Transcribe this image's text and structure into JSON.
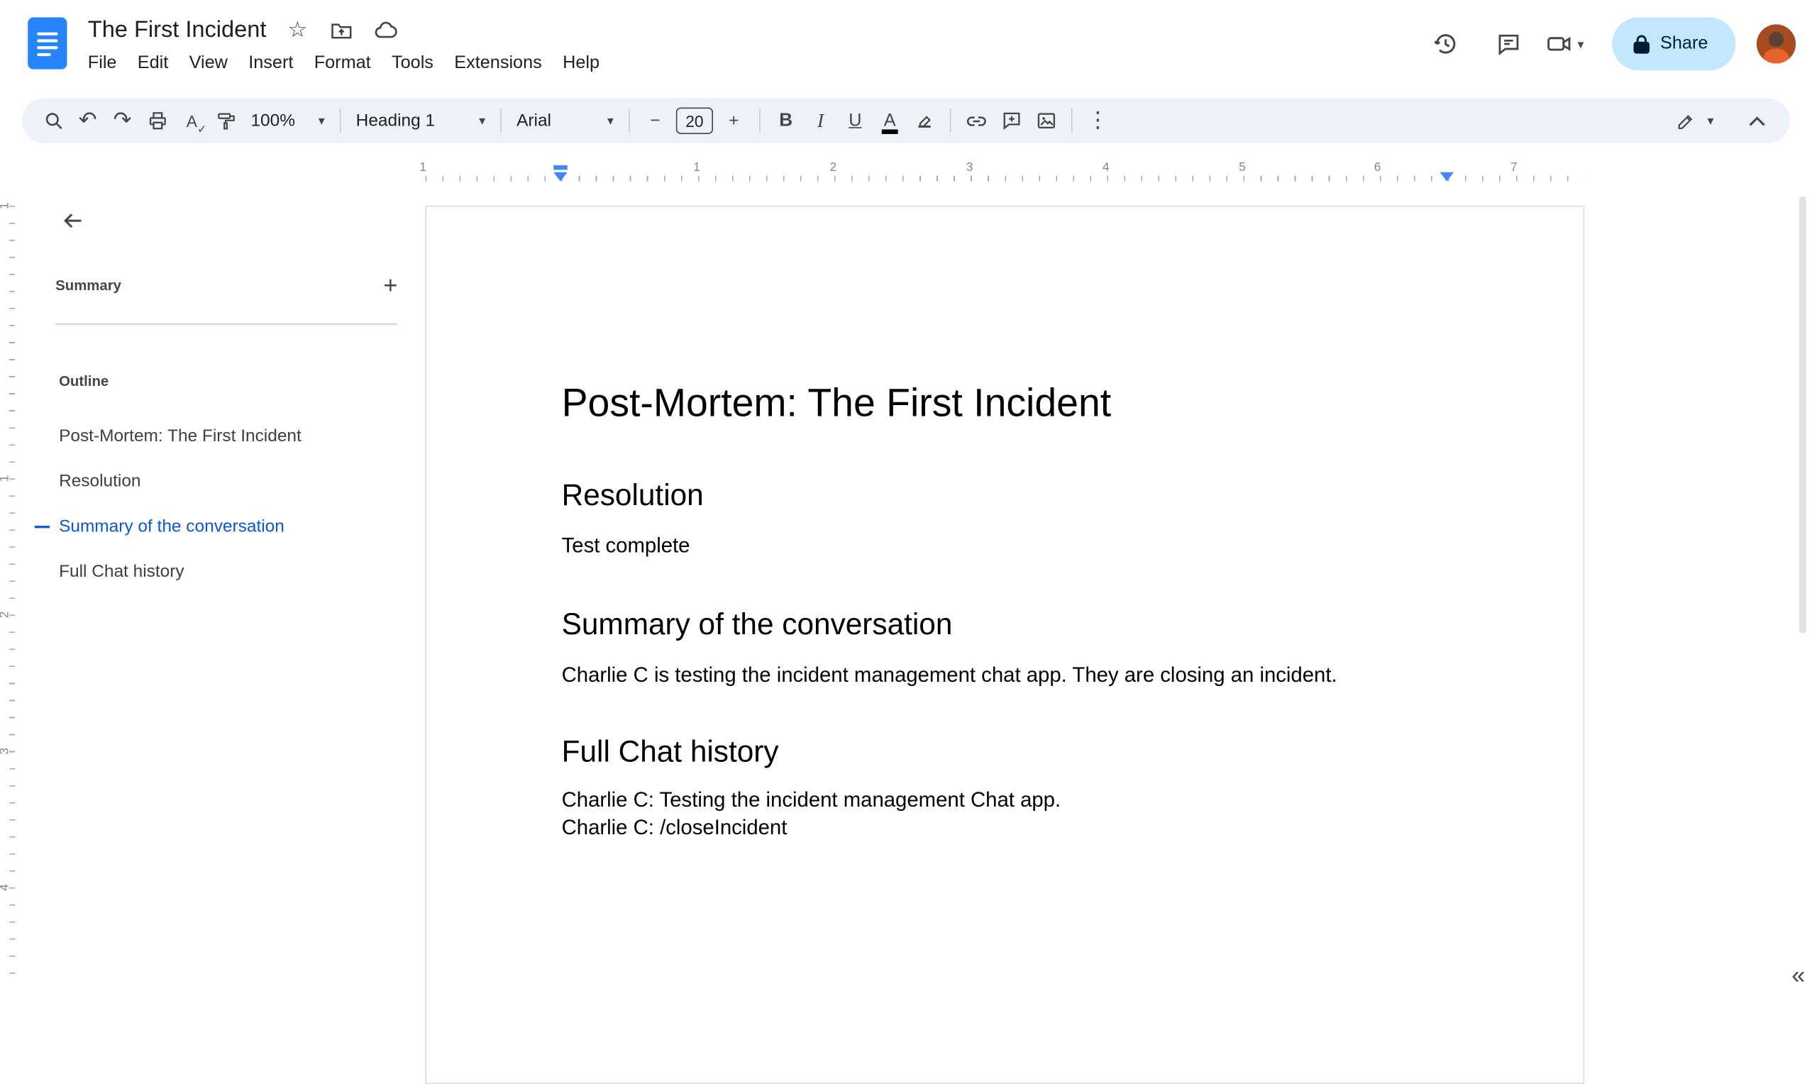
{
  "header": {
    "doc_title": "The First Incident",
    "menus": [
      "File",
      "Edit",
      "View",
      "Insert",
      "Format",
      "Tools",
      "Extensions",
      "Help"
    ],
    "share_label": "Share"
  },
  "toolbar": {
    "zoom_value": "100%",
    "style_value": "Heading 1",
    "font_value": "Arial",
    "font_size_value": "20",
    "bold_label": "B",
    "italic_label": "I",
    "underline_label": "U",
    "text_color_label": "A",
    "spellcheck_label": "A"
  },
  "icons": {
    "star": "☆",
    "undo": "↶",
    "redo": "↷",
    "minus": "−",
    "plus": "+",
    "add": "+",
    "caret": "▾",
    "more_vert": "⋮",
    "spell_check_mark": "✓",
    "collapse_panel": "«"
  },
  "ruler": {
    "h_numbers": [
      "1",
      "1",
      "2",
      "3",
      "4",
      "5",
      "6",
      "7"
    ],
    "v_numbers": [
      "1",
      "1",
      "2",
      "3",
      "4"
    ]
  },
  "sidebar": {
    "summary_label": "Summary",
    "outline_label": "Outline",
    "items": [
      {
        "label": "Post-Mortem: The First Incident",
        "active": false
      },
      {
        "label": "Resolution",
        "active": false
      },
      {
        "label": "Summary of the conversation",
        "active": true
      },
      {
        "label": "Full Chat history",
        "active": false
      }
    ]
  },
  "document": {
    "title": "Post-Mortem: The First Incident",
    "sections": [
      {
        "heading": "Resolution",
        "paragraphs": [
          "Test complete"
        ]
      },
      {
        "heading": "Summary of the conversation",
        "paragraphs": [
          "Charlie C is testing the incident management chat app. They are closing an incident."
        ]
      },
      {
        "heading": "Full Chat history",
        "paragraphs": [
          "Charlie C: Testing the incident management Chat app.",
          "Charlie C: /closeIncident"
        ]
      }
    ]
  },
  "colors": {
    "accent_blue": "#0b57d0",
    "share_bg": "#c2e7ff",
    "toolbar_bg": "#edf2fa",
    "ruler_marker": "#4285f4"
  }
}
